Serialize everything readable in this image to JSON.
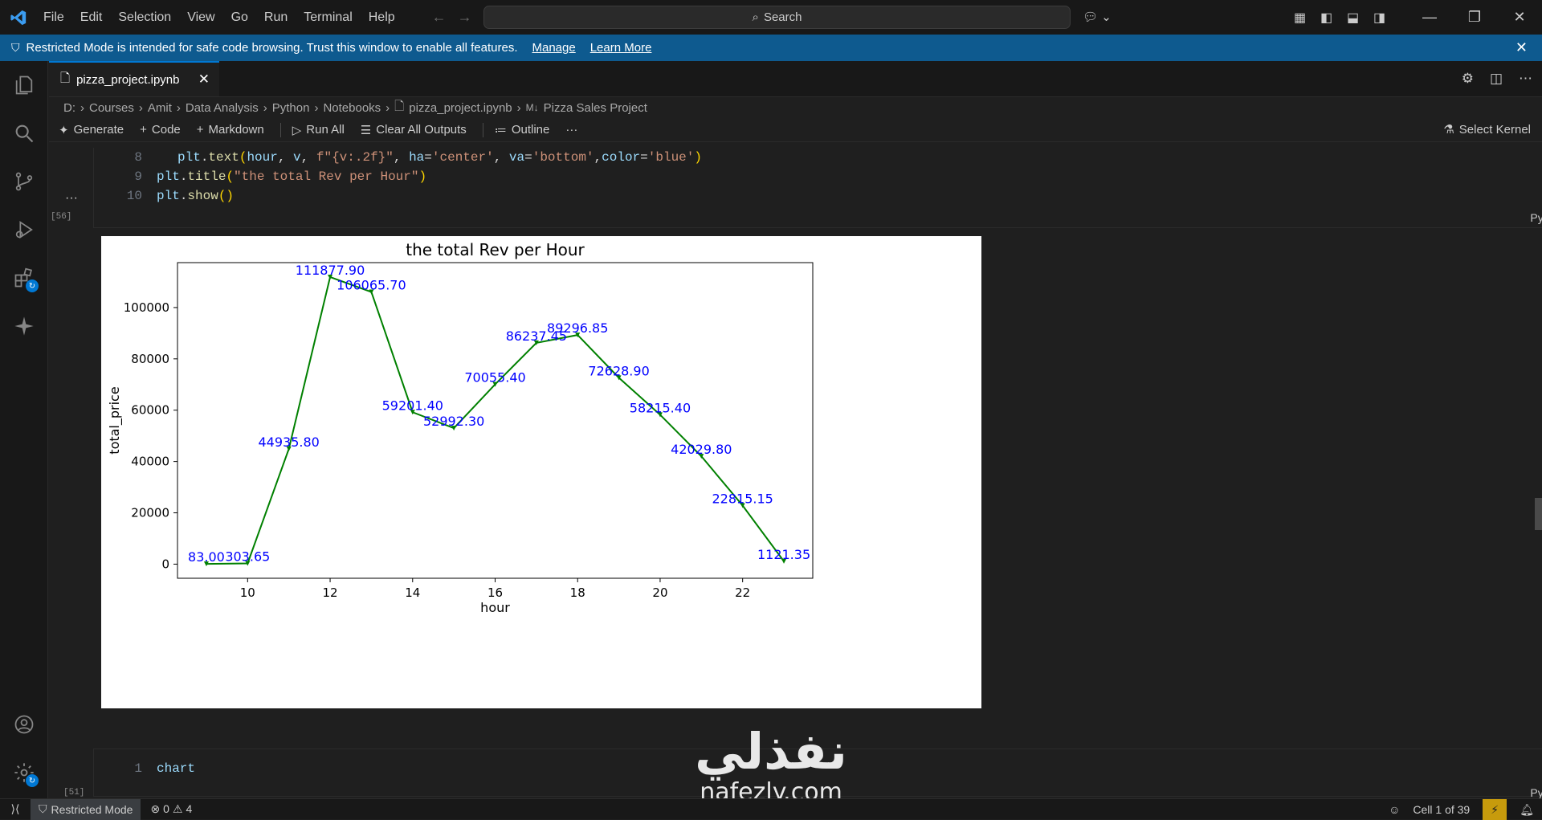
{
  "menu": [
    "File",
    "Edit",
    "Selection",
    "View",
    "Go",
    "Run",
    "Terminal",
    "Help"
  ],
  "search": {
    "label": "Search"
  },
  "banner": {
    "text": "Restricted Mode is intended for safe code browsing. Trust this window to enable all features.",
    "manage": "Manage",
    "learn_more": "Learn More"
  },
  "tab": {
    "label": "pizza_project.ipynb"
  },
  "breadcrumb": [
    "D:",
    "Courses",
    "Amit",
    "Data Analysis",
    "Python",
    "Notebooks",
    "pizza_project.ipynb",
    "Pizza Sales Project"
  ],
  "toolbar": {
    "generate": "Generate",
    "code": "Code",
    "markdown": "Markdown",
    "run_all": "Run All",
    "clear_outputs": "Clear All Outputs",
    "outline": "Outline",
    "more": "···",
    "kernel": "Select Kernel"
  },
  "cell1": {
    "exec": "[56]",
    "lang": "Python",
    "lines": [
      {
        "n": "8"
      },
      {
        "n": "9"
      },
      {
        "n": "10"
      }
    ]
  },
  "output_dots": "···",
  "cell2": {
    "exec": "[51]",
    "lang": "Python",
    "line_number": "1",
    "code": "chart"
  },
  "chart_data": {
    "type": "line",
    "title": "the total Rev per Hour",
    "xlabel": "hour",
    "ylabel": "total_price",
    "x": [
      9,
      10,
      11,
      12,
      13,
      14,
      15,
      16,
      17,
      18,
      19,
      20,
      21,
      22,
      23
    ],
    "values": [
      83.0,
      303.65,
      44935.8,
      111877.9,
      106065.7,
      59201.4,
      52992.3,
      70055.4,
      86237.45,
      89296.85,
      72628.9,
      58215.4,
      42029.8,
      22815.15,
      1121.35
    ],
    "labels": [
      "83.00",
      "303.65",
      "44935.80",
      "111877.90",
      "106065.70",
      "59201.40",
      "52992.30",
      "70055.40",
      "86237.45",
      "89296.85",
      "72628.90",
      "58215.40",
      "42029.80",
      "22815.15",
      "1121.35"
    ],
    "xticks": [
      "10",
      "12",
      "14",
      "16",
      "18",
      "20",
      "22"
    ],
    "yticks": [
      "0",
      "20000",
      "40000",
      "60000",
      "80000",
      "100000"
    ],
    "xlim": [
      8.3,
      23.7
    ],
    "ylim": [
      -5500,
      117500
    ],
    "line_color": "#008000",
    "label_color": "#0000ff",
    "grid": false
  },
  "status": {
    "restricted": "Restricted Mode",
    "errors": "0",
    "warnings": "4",
    "cell": "Cell 1 of 39"
  },
  "watermark": {
    "arabic": "نفذلي",
    "latin": "nafezly.com"
  }
}
